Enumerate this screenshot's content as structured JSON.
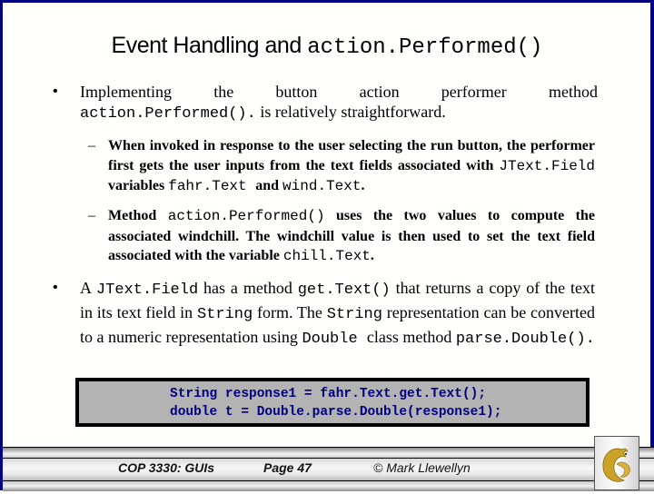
{
  "slide": {
    "title": {
      "text": "Event Handling and ",
      "code": "action.Performed()"
    },
    "bullets": [
      {
        "marker": "•",
        "line1_words": [
          "Implementing",
          "the",
          "button",
          "action",
          "performer",
          "method"
        ],
        "line2_code": "action.Performed().",
        "line2_text": " is relatively straightforward."
      },
      {
        "marker": "•",
        "parts": [
          {
            "type": "text",
            "value": "A "
          },
          {
            "type": "code",
            "value": "JText.Field"
          },
          {
            "type": "text",
            "value": " has a method "
          },
          {
            "type": "code",
            "value": "get.Text()"
          },
          {
            "type": "text",
            "value": " that returns a copy of the text in its text field in "
          },
          {
            "type": "code",
            "value": "String"
          },
          {
            "type": "text",
            "value": " form.  The "
          },
          {
            "type": "code",
            "value": "String"
          },
          {
            "type": "text",
            "value": " representation can be converted to a numeric representation using "
          },
          {
            "type": "code",
            "value": "Double "
          },
          {
            "type": "text",
            "value": " class method "
          },
          {
            "type": "code",
            "value": "parse.Double()."
          }
        ]
      }
    ],
    "subbullets": [
      {
        "marker": "–",
        "parts": [
          {
            "type": "text",
            "value": "When invoked in response to the user selecting the run button, the performer first gets the user inputs from the text fields associated with "
          },
          {
            "type": "code",
            "value": "JText.Field"
          },
          {
            "type": "text",
            "value": " variables "
          },
          {
            "type": "code",
            "value": "fahr.Text "
          },
          {
            "type": "text",
            "value": " and "
          },
          {
            "type": "code",
            "value": "wind.Text"
          },
          {
            "type": "text",
            "value": "."
          }
        ]
      },
      {
        "marker": "–",
        "parts": [
          {
            "type": "text",
            "value": "Method "
          },
          {
            "type": "code",
            "value": "action.Performed()"
          },
          {
            "type": "text",
            "value": " uses the two values to compute the associated windchill.  The windchill value is then used to set the text field associated with the variable "
          },
          {
            "type": "code",
            "value": "chill.Text"
          },
          {
            "type": "text",
            "value": "."
          }
        ]
      }
    ],
    "code_block": {
      "lines": [
        "String response1 = fahr.Text.get.Text();",
        "double t = Double.parse.Double(response1);"
      ]
    }
  },
  "footer": {
    "course": "COP 3330:  GUIs",
    "page": "Page 47",
    "author": "© Mark Llewellyn",
    "logo_icon": "ucf-pegasus-logo-icon"
  },
  "colors": {
    "frame": "#000080",
    "code_text": "#000080",
    "code_bg": "#b3b3b3",
    "logo_gold": "#c9a227"
  }
}
